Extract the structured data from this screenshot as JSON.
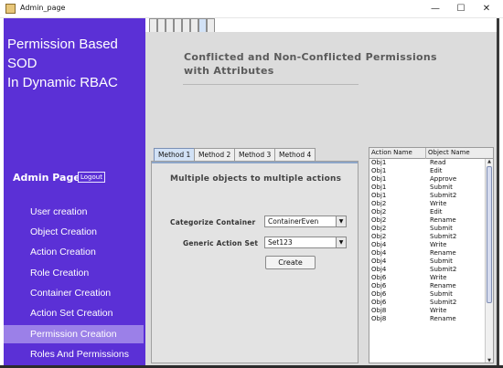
{
  "window": {
    "title": "Admin_page",
    "controls": {
      "minimize": "—",
      "maximize": "☐",
      "close": "✕"
    }
  },
  "sidebar": {
    "brand_line1": "Permission Based SOD",
    "brand_line2": "In Dynamic RBAC",
    "admin_label": "Admin Page",
    "logout_label": "Logout",
    "items": [
      {
        "label": "User creation",
        "active": false
      },
      {
        "label": "Object Creation",
        "active": false
      },
      {
        "label": "Action Creation",
        "active": false
      },
      {
        "label": "Role Creation",
        "active": false
      },
      {
        "label": "Container Creation",
        "active": false
      },
      {
        "label": "Action Set Creation",
        "active": false
      },
      {
        "label": "Permission Creation",
        "active": true
      },
      {
        "label": "Roles And Permissions",
        "active": false
      }
    ],
    "colors": {
      "background": "#5b30d6",
      "active_item": "#9b80e8"
    }
  },
  "main": {
    "heading_line1": "Conflicted and Non-Conflicted Permissions",
    "heading_line2": "with Attributes",
    "method_tabs": [
      {
        "label": "Method 1",
        "active": true
      },
      {
        "label": "Method 2",
        "active": false
      },
      {
        "label": "Method 3",
        "active": false
      },
      {
        "label": "Method 4",
        "active": false
      }
    ],
    "method_panel": {
      "subheading": "Multiple objects to multiple actions",
      "container_label": "Categorize Container",
      "container_value": "ContainerEven",
      "actionset_label": "Generic Action Set",
      "actionset_value": "Set123",
      "create_label": "Create"
    }
  },
  "permissions_table": {
    "headers": [
      "Action Name",
      "Object Name"
    ],
    "rows": [
      [
        "Obj1",
        "Read"
      ],
      [
        "Obj1",
        "Edit"
      ],
      [
        "Obj1",
        "Approve"
      ],
      [
        "Obj1",
        "Submit"
      ],
      [
        "Obj1",
        "Submit2"
      ],
      [
        "Obj2",
        "Write"
      ],
      [
        "Obj2",
        "Edit"
      ],
      [
        "Obj2",
        "Rename"
      ],
      [
        "Obj2",
        "Submit"
      ],
      [
        "Obj2",
        "Submit2"
      ],
      [
        "Obj4",
        "Write"
      ],
      [
        "Obj4",
        "Rename"
      ],
      [
        "Obj4",
        "Submit"
      ],
      [
        "Obj4",
        "Submit2"
      ],
      [
        "Obj6",
        "Write"
      ],
      [
        "Obj6",
        "Rename"
      ],
      [
        "Obj6",
        "Submit"
      ],
      [
        "Obj6",
        "Submit2"
      ],
      [
        "Obj8",
        "Write"
      ],
      [
        "Obj8",
        "Rename"
      ]
    ]
  }
}
